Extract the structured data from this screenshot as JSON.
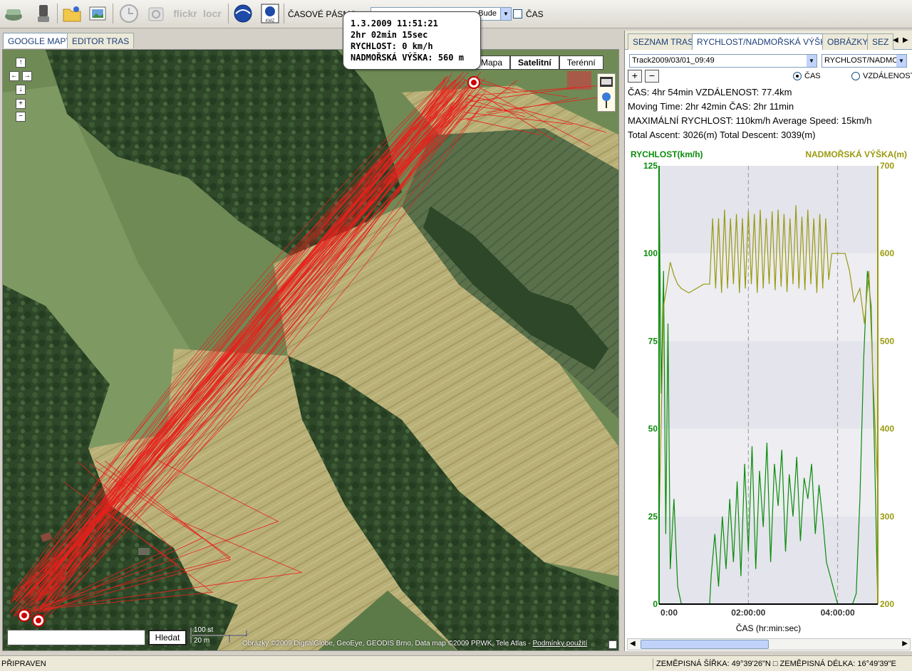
{
  "toolbar": {
    "icons": [
      "save-icon",
      "device-icon",
      "open-folder-icon",
      "image-icon",
      "clock-icon",
      "camera-icon",
      "flickr-icon",
      "locr-icon",
      "google-earth-icon",
      "kmz-icon"
    ],
    "flickr_label": "flickr",
    "locr_label": "locr",
    "kmz_label": "KMZ",
    "timezone_label": "ČASOVÉ PÁSMO",
    "timezone_value": "Bude",
    "cas_checkbox_label": "ČAS"
  },
  "left_tabs": [
    "GOOGLE MAPY",
    "EDITOR TRAS"
  ],
  "map": {
    "types": [
      "Mapa",
      "Satelitní",
      "Terénní"
    ],
    "active_type": "Satelitní",
    "search_button": "Hledat",
    "search_value": "",
    "scale_top": "100 st",
    "scale_bottom": "20 m",
    "copyright": "Obrázky ©2009 DigitalGlobe, GeoEye, GEODIS Brno, Data map ©2009 PPWK, Tele Atlas - ",
    "terms_link": "Podmínky použití",
    "tooltip": [
      "1.3.2009 11:51:21",
      "2hr 02min 15sec",
      "RYCHLOST: 0 km/h",
      "NADMOŘSKÁ VÝŠKA: 560 m"
    ],
    "nav_buttons": [
      "↑",
      "←",
      "→",
      "↓",
      "+",
      "−"
    ],
    "track_color": "#e8201c"
  },
  "right_tabs": [
    "SEZNAM TRAS",
    "RYCHLOST/NADMOŘSKÁ VÝŠKA",
    "OBRÁZKY",
    "SEZ"
  ],
  "panel": {
    "track_select": "Track2009/03/01_09:49",
    "mode_select": "RYCHLOST/NADMOŘ",
    "radio_time": "ČAS",
    "radio_distance": "VZDÁLENOST",
    "stats": [
      "ČAS: 4hr 54min  VZDÁLENOST: 77.4km",
      "Moving Time: 2hr 42min  ČAS: 2hr 11min",
      "MAXIMÁLNÍ RYCHLOST: 110km/h  Average Speed: 15km/h",
      "Total Ascent: 3026(m)  Total Descent: 3039(m)"
    ]
  },
  "chart_data": {
    "type": "line",
    "left_axis_label": "RYCHLOST(km/h)",
    "right_axis_label": "NADMOŘSKÁ VÝŠKA(m)",
    "xlabel": "ČAS (hr:min:sec)",
    "x_ticks": [
      "0:00",
      "02:00:00",
      "04:00:00"
    ],
    "x_tick_minutes": [
      0,
      120,
      240
    ],
    "xlim_minutes": [
      0,
      294
    ],
    "ylim_left": [
      0,
      125
    ],
    "y_ticks_left": [
      0,
      25,
      50,
      75,
      100,
      125
    ],
    "ylim_right": [
      200,
      700
    ],
    "y_ticks_right": [
      200,
      300,
      400,
      500,
      600,
      700
    ],
    "speed_color": "#0a8c0a",
    "altitude_color": "#9a9a10",
    "series": [
      {
        "name": "RYCHLOST(km/h)",
        "axis": "left",
        "x": [
          0,
          3,
          6,
          9,
          12,
          15,
          20,
          25,
          30,
          40,
          50,
          60,
          68,
          70,
          75,
          80,
          85,
          90,
          95,
          100,
          105,
          110,
          115,
          120,
          125,
          130,
          135,
          140,
          145,
          150,
          155,
          160,
          165,
          170,
          175,
          180,
          185,
          190,
          195,
          200,
          205,
          210,
          215,
          220,
          225,
          230,
          240,
          250,
          255,
          260,
          265,
          270,
          275,
          280,
          285,
          290,
          294
        ],
        "values": [
          120,
          60,
          95,
          20,
          80,
          10,
          30,
          5,
          0,
          0,
          0,
          0,
          0,
          8,
          20,
          5,
          25,
          10,
          30,
          12,
          35,
          8,
          40,
          15,
          45,
          10,
          38,
          22,
          46,
          12,
          40,
          28,
          44,
          15,
          37,
          25,
          42,
          18,
          36,
          30,
          40,
          20,
          34,
          24,
          12,
          8,
          0,
          0,
          0,
          0,
          3,
          30,
          70,
          95,
          85,
          40,
          0
        ]
      },
      {
        "name": "NADMOŘSKÁ VÝŠKA(m)",
        "axis": "right",
        "x": [
          0,
          6,
          10,
          15,
          20,
          25,
          30,
          40,
          50,
          60,
          68,
          72,
          76,
          80,
          84,
          88,
          92,
          96,
          100,
          104,
          108,
          112,
          116,
          120,
          124,
          128,
          132,
          136,
          140,
          144,
          148,
          152,
          156,
          160,
          164,
          168,
          172,
          176,
          180,
          184,
          188,
          192,
          196,
          200,
          204,
          208,
          212,
          216,
          220,
          224,
          228,
          232,
          240,
          250,
          256,
          262,
          270,
          276,
          282,
          288,
          294
        ],
        "values": [
          290,
          540,
          560,
          590,
          575,
          565,
          560,
          555,
          560,
          565,
          565,
          640,
          560,
          640,
          555,
          650,
          560,
          640,
          565,
          645,
          555,
          640,
          560,
          648,
          565,
          645,
          555,
          650,
          560,
          640,
          565,
          648,
          558,
          650,
          562,
          645,
          556,
          640,
          565,
          655,
          560,
          642,
          558,
          650,
          565,
          640,
          555,
          645,
          560,
          640,
          570,
          600,
          600,
          600,
          580,
          545,
          560,
          520,
          580,
          450,
          330
        ]
      }
    ],
    "markers_minutes": [
      120,
      240
    ]
  },
  "status": {
    "text": "PŘIPRAVEN",
    "coords": "ZEMĚPISNÁ ŠÍŘKA: 49°39'26\"N □ ZEMĚPISNÁ DÉLKA: 16°49'39\"E"
  }
}
